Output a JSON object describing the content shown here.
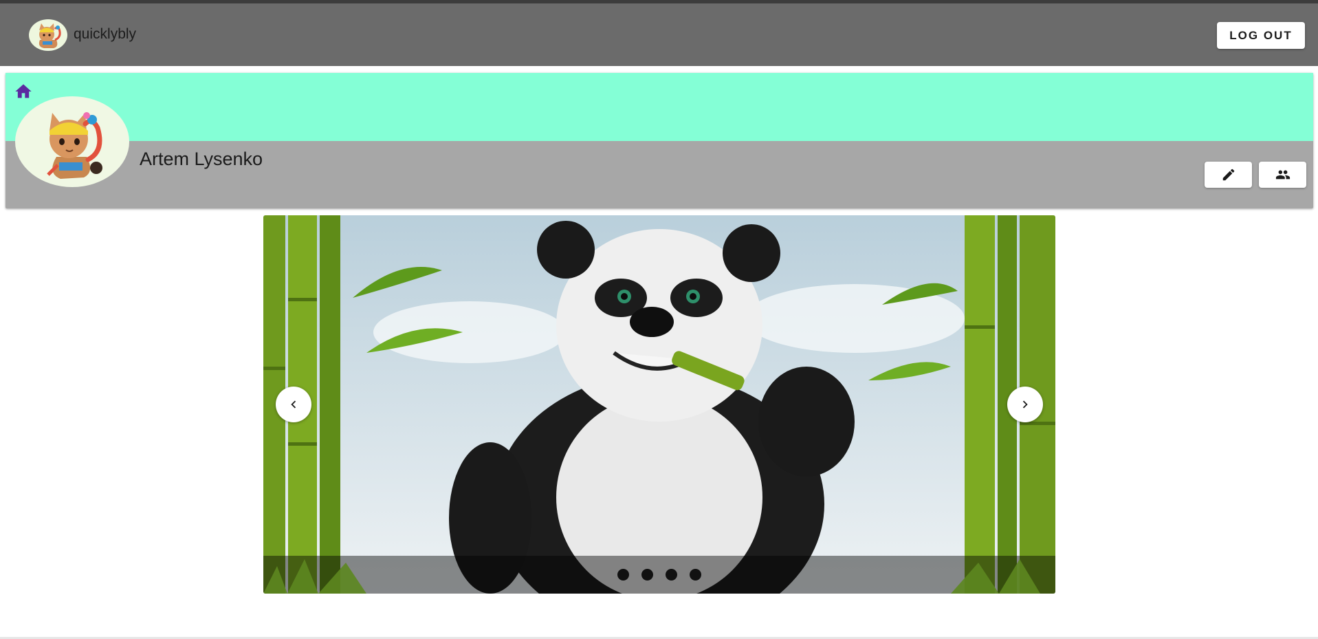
{
  "header": {
    "username": "quicklybly",
    "logout_label": "LOG OUT",
    "avatar_icon": "cat-avatar-icon",
    "bar_color": "#6b6b6b"
  },
  "profile": {
    "name": "Artem Lysenko",
    "cover_color": "#84ffd6",
    "home_icon": "home-icon",
    "edit_icon": "pencil-icon",
    "friends_icon": "people-icon",
    "accent_color": "#5b2aa0"
  },
  "carousel": {
    "slide_count": 4,
    "active_index": 0,
    "current_image": "panda-eating-bamboo",
    "prev_icon": "chevron-left-icon",
    "next_icon": "chevron-right-icon"
  }
}
